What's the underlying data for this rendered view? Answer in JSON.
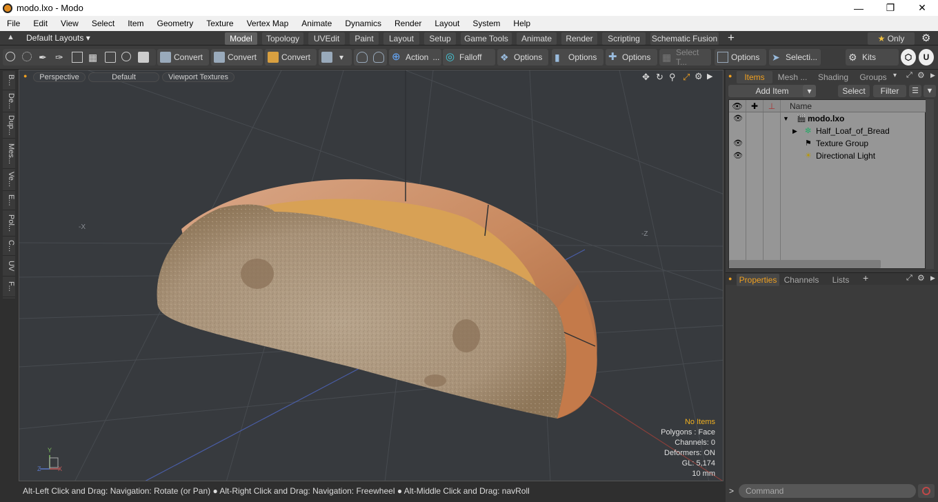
{
  "window": {
    "title": "modo.lxo - Modo"
  },
  "menubar": {
    "items": [
      "File",
      "Edit",
      "View",
      "Select",
      "Item",
      "Geometry",
      "Texture",
      "Vertex Map",
      "Animate",
      "Dynamics",
      "Render",
      "Layout",
      "System",
      "Help"
    ]
  },
  "layoutbar": {
    "layouts_label": "Default Layouts",
    "tabs": [
      "Model",
      "Topology",
      "UVEdit",
      "Paint",
      "Layout",
      "Setup",
      "Game Tools",
      "Animate",
      "Render",
      "Scripting",
      "Schematic Fusion"
    ],
    "only_label": "Only"
  },
  "toolbar": {
    "convert1": "Convert",
    "convert2": "Convert",
    "convert3": "Convert",
    "action": "Action",
    "falloff": "Falloff",
    "options1": "Options",
    "options2": "Options",
    "options3": "Options",
    "select_t": "Select T...",
    "options4": "Options",
    "selecti": "Selecti...",
    "kits": "Kits"
  },
  "lefttabs": [
    "B...",
    "De...",
    "Dup...",
    "Mes...",
    "Ve...",
    "E...",
    "Pol...",
    "C...",
    "UV",
    "F..."
  ],
  "viewport": {
    "perspective": "Perspective",
    "default": "Default",
    "textures": "Viewport Textures",
    "axis_x": "-X",
    "axis_z": "-Z",
    "info": {
      "no_items": "No Items",
      "polygons": "Polygons : Face",
      "channels": "Channels: 0",
      "deformers": "Deformers: ON",
      "gl": "GL: 5,174",
      "scale": "10 mm"
    }
  },
  "statusbar": {
    "text": "Alt-Left Click and Drag: Navigation: Rotate (or Pan) ● Alt-Right Click and Drag: Navigation: Freewheel ● Alt-Middle Click and Drag: navRoll"
  },
  "rightpanel": {
    "tabs": [
      "Items",
      "Mesh ...",
      "Shading",
      "Groups"
    ],
    "add_item": "Add Item",
    "select": "Select",
    "filter": "Filter",
    "col_name": "Name",
    "tree": [
      {
        "label": "modo.lxo",
        "bold": true
      },
      {
        "label": "Half_Loaf_of_Bread"
      },
      {
        "label": "Texture Group"
      },
      {
        "label": "Directional Light"
      }
    ],
    "bottom_tabs": [
      "Properties",
      "Channels",
      "Lists"
    ],
    "command_placeholder": "Command"
  },
  "colors": {
    "accent": "#f0a020",
    "background": "#3b3b3b",
    "viewport": "#373a3e"
  }
}
